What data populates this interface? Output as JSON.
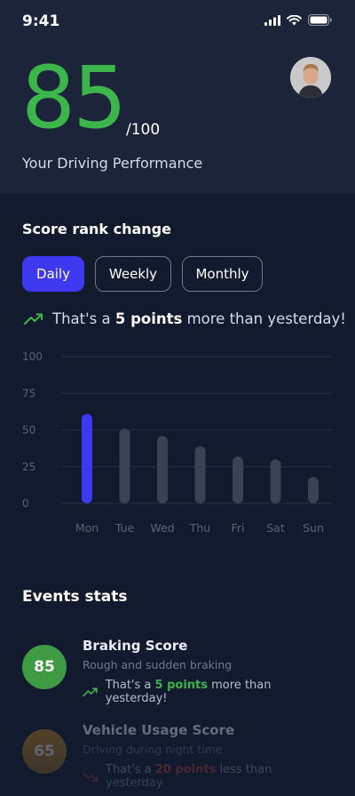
{
  "status_bar": {
    "time": "9:41"
  },
  "hero": {
    "score": "85",
    "score_total": "/100",
    "label": "Your Driving Performance"
  },
  "score_rank": {
    "title": "Score rank change",
    "tabs": [
      {
        "label": "Daily",
        "active": true
      },
      {
        "label": "Weekly",
        "active": false
      },
      {
        "label": "Monthly",
        "active": false
      }
    ],
    "trend": {
      "prefix": "That's a ",
      "highlight": "5 points",
      "suffix": " more than yesterday!"
    }
  },
  "chart_data": {
    "type": "bar",
    "categories": [
      "Mon",
      "Tue",
      "Wed",
      "Thu",
      "Fri",
      "Sat",
      "Sun"
    ],
    "values": [
      61,
      51,
      46,
      39,
      32,
      30,
      18
    ],
    "yticks": [
      100,
      75,
      50,
      25,
      0
    ],
    "ylim": [
      0,
      100
    ],
    "highlight_index": 0,
    "grid": true,
    "colors": {
      "highlight": "#3e38f0",
      "bar": "#3a4254",
      "grid": "#26304a"
    }
  },
  "events": {
    "title": "Events stats",
    "items": [
      {
        "score": "85",
        "title": "Braking Score",
        "subtitle": "Rough and sudden braking",
        "trend_prefix": "That's a ",
        "trend_highlight": "5 points",
        "trend_suffix": " more than yesterday!",
        "color": "#3cb54a"
      },
      {
        "score": "65",
        "title": "Vehicle Usage Score",
        "subtitle": "Driving during night time",
        "trend_prefix": "That's a ",
        "trend_highlight": "20 points",
        "trend_suffix": " less than yesterday",
        "color": "#d4972a"
      }
    ]
  },
  "colors": {
    "accent": "#3e38f0",
    "positive": "#3cb54a",
    "negative": "#e04a3a",
    "warning": "#d4972a"
  }
}
